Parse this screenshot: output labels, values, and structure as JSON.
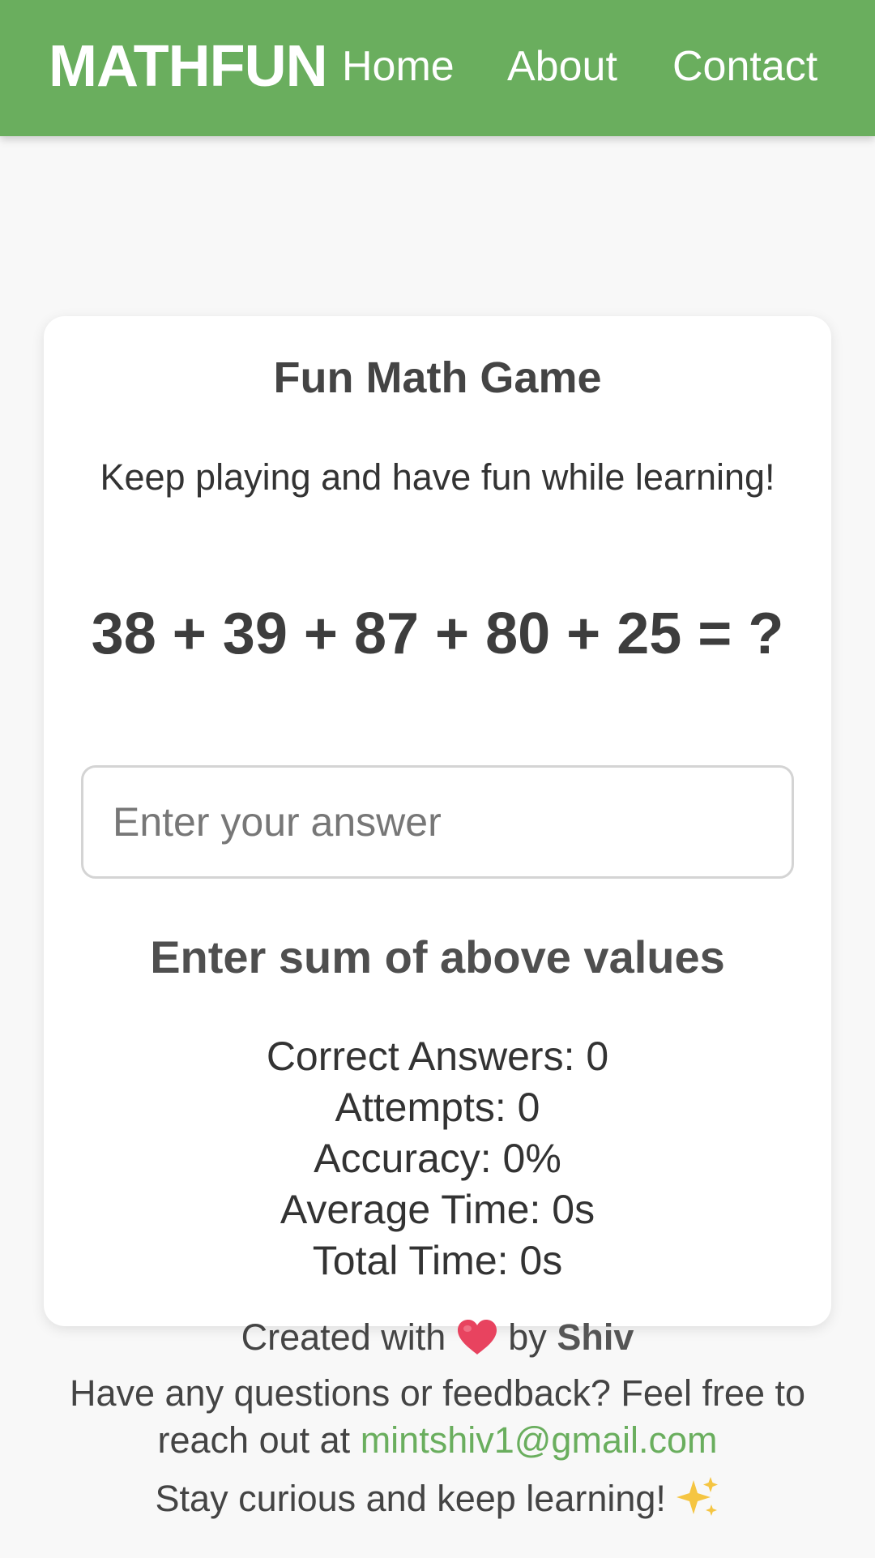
{
  "header": {
    "brand": "MATHFUN",
    "nav": [
      {
        "label": "Home"
      },
      {
        "label": "About"
      },
      {
        "label": "Contact"
      }
    ]
  },
  "game": {
    "title": "Fun Math Game",
    "subtitle": "Keep playing and have fun while learning!",
    "question": "38 + 39 + 87 + 80 + 25 = ?",
    "input": {
      "placeholder": "Enter your answer",
      "value": ""
    },
    "hint": "Enter sum of above values",
    "stats": [
      "Correct Answers: 0",
      "Attempts: 0",
      "Accuracy: 0%",
      "Average Time: 0s",
      "Total Time: 0s"
    ]
  },
  "footer": {
    "created_prefix": "Created with",
    "created_by": "by",
    "author": "Shiv",
    "contact_text": "Have any questions or feedback? Feel free to reach out at",
    "email": "mintshiv1@gmail.com",
    "closing": "Stay curious and keep learning!"
  },
  "icons": {
    "heart": "heart-icon",
    "sparkle": "sparkle-icon"
  },
  "colors": {
    "brand_green": "#6aae5e",
    "background": "#f8f8f8",
    "card": "#ffffff",
    "heart": "#e8435f",
    "sparkle": "#f5c542"
  }
}
